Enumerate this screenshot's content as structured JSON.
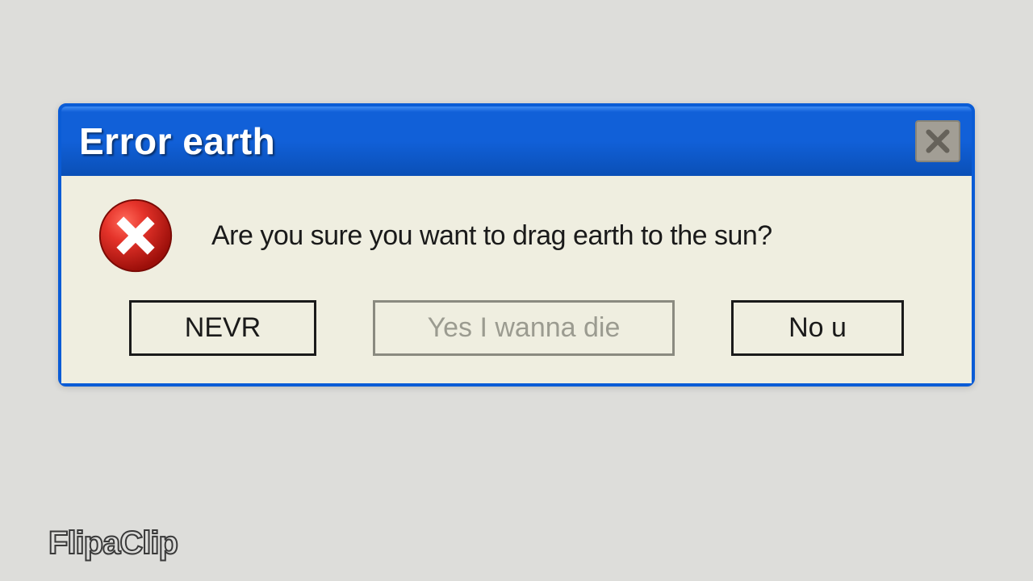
{
  "dialog": {
    "title": "Error earth",
    "message": "Are you sure you want to drag earth to the sun?",
    "buttons": {
      "nevr": "NEVR",
      "yes": "Yes I wanna die",
      "nou": "No u"
    },
    "icon": "error-icon",
    "colors": {
      "titlebar": "#1160d8",
      "body_bg": "#efeee0",
      "error_red": "#d2201e"
    }
  },
  "watermark": "FlipaClip"
}
